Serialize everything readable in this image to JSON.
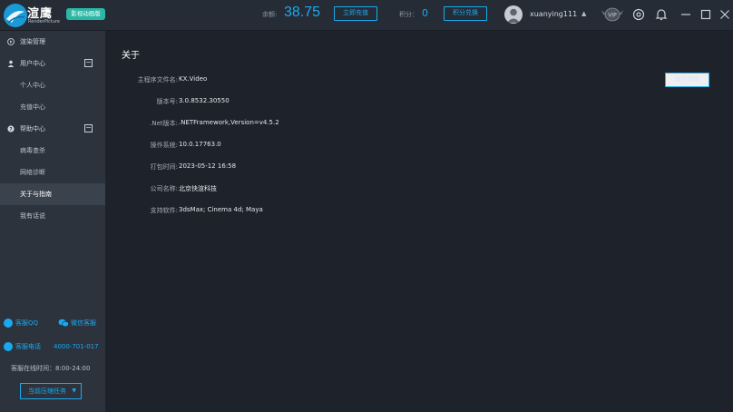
{
  "header": {
    "logo_text": "渲鹰",
    "logo_sub": "RenderPicture",
    "edition": "影视动画版",
    "balance_label": "余额:",
    "balance_value": "38.75",
    "recharge_label": "立即充值",
    "points_label": "积分：",
    "points_value": "0",
    "exchange_label": "积分兑换",
    "username": "xuanying111",
    "vip_label": "VIP"
  },
  "sidebar": {
    "items": [
      {
        "label": "渲染管理",
        "type": "main"
      },
      {
        "label": "用户中心",
        "type": "group"
      },
      {
        "label": "个人中心",
        "type": "sub"
      },
      {
        "label": "充值中心",
        "type": "sub"
      },
      {
        "label": "帮助中心",
        "type": "group"
      },
      {
        "label": "病毒查杀",
        "type": "sub"
      },
      {
        "label": "网络诊断",
        "type": "sub"
      },
      {
        "label": "关于与指南",
        "type": "sub",
        "active": true
      },
      {
        "label": "我有话说",
        "type": "sub"
      }
    ],
    "support": {
      "qq_label": "客服QQ",
      "wechat_label": "微信客服",
      "phone_label": "客服电话",
      "phone_number": "4000-701-017",
      "hours": "客服在线时间：8:00-24:00",
      "queue_label": "当前压缩任务"
    }
  },
  "main": {
    "title": "关于",
    "guide_button": "操作指南",
    "info": [
      {
        "label": "主程序文件名:",
        "value": "KX.Video"
      },
      {
        "label": "版本号:",
        "value": "3.0.8532.30550"
      },
      {
        "label": ".Net版本:",
        "value": ".NETFramework,Version=v4.5.2"
      },
      {
        "label": "操作系统:",
        "value": "10.0.17763.0"
      },
      {
        "label": "打包时间:",
        "value": "2023-05-12 16:58"
      },
      {
        "label": "公司名称:",
        "value": "北京快渲科技"
      },
      {
        "label": "支持软件:",
        "value": "3dsMax; Cinema 4d; Maya"
      }
    ]
  },
  "colors": {
    "accent": "#1aa9f0",
    "badge": "#2bb7a6",
    "sidebar_bg": "#2c333d",
    "main_bg": "#1e232b",
    "header_bg": "#262c35"
  }
}
